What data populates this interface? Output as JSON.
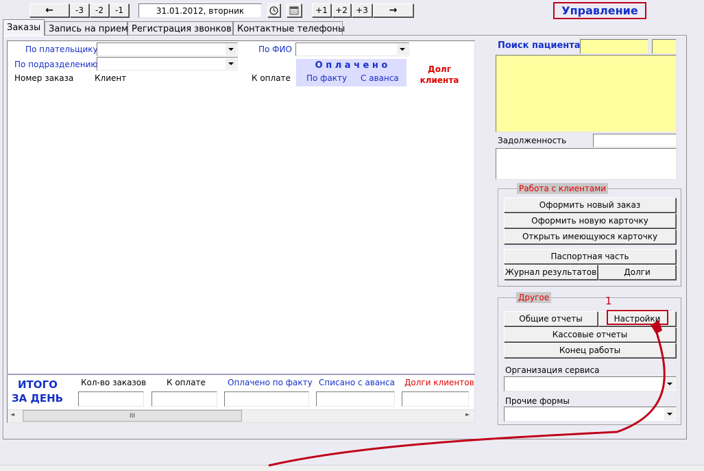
{
  "nav": {
    "back": "←",
    "m3": "-3",
    "m2": "-2",
    "m1": "-1",
    "date": "31.01.2012, вторник",
    "p1": "+1",
    "p2": "+2",
    "p3": "+3",
    "forward": "→"
  },
  "header": {
    "title": "Управление"
  },
  "tabs": [
    "Заказы",
    "Запись на прием",
    "Регистрация звонков",
    "Контактные телефоны"
  ],
  "filters": {
    "payer_label": "По плательщику",
    "department_label": "По подразделению",
    "fio_label": "По ФИО",
    "payer_value": "",
    "department_value": "",
    "fio_value": ""
  },
  "columns": {
    "order_number": "Номер заказа",
    "client": "Клиент",
    "to_pay": "К оплате",
    "paid_title": "О п л а ч е н о",
    "paid_fact": "По факту",
    "paid_advance": "С аванса",
    "debt_line1": "Долг",
    "debt_line2": "клиента"
  },
  "totals": {
    "title_line1": "ИТОГО",
    "title_line2": "ЗА ДЕНЬ",
    "count_label": "Кол-во заказов",
    "to_pay_label": "К оплате",
    "paid_fact_label": "Оплачено по факту",
    "advance_label": "Списано с аванса",
    "debts_label": "Долги клиентов",
    "count": "",
    "to_pay": "",
    "paid_fact": "",
    "advance": "",
    "debts": ""
  },
  "scrollbar": {
    "grip": "III",
    "left": "◄",
    "right": "►"
  },
  "patient": {
    "search_label": "Поиск пациента",
    "search_value": "",
    "search_value2": "",
    "debt_label": "Задолженность",
    "debt_value": ""
  },
  "clients_group": {
    "title": "Работа с клиентами",
    "new_order": "Оформить новый заказ",
    "new_card": "Оформить новую карточку",
    "open_card": "Открыть имеющуюся карточку",
    "passport": "Паспортная часть",
    "results_log": "Журнал результатов",
    "debts": "Долги"
  },
  "other_group": {
    "title": "Другое",
    "reports": "Общие отчеты",
    "settings": "Настройки",
    "cash_reports": "Кассовые отчеты",
    "end_work": "Конец работы",
    "org_label": "Организация сервиса",
    "other_forms_label": "Прочие формы",
    "org_value": "",
    "other_forms_value": ""
  },
  "annotation": {
    "number": "1",
    "color": "#c00018"
  },
  "colors": {
    "accent_blue": "#1530c8",
    "accent_red": "#e00000",
    "highlight_yellow": "#ffffa0"
  }
}
